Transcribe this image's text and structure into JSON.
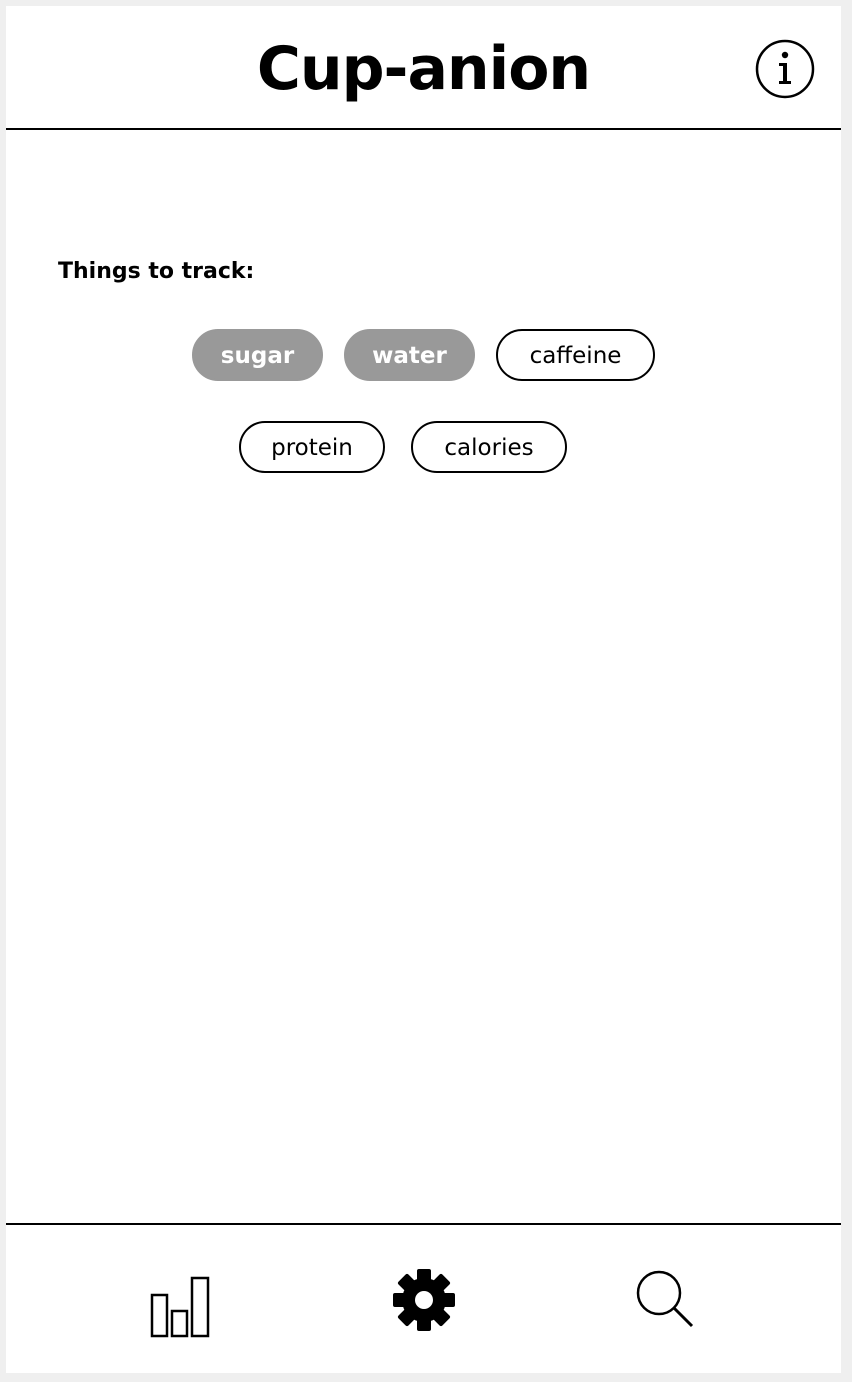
{
  "header": {
    "title": "Cup-anion",
    "info_icon": "info-circle-icon"
  },
  "tracking": {
    "label": "Things to track:",
    "chips": [
      {
        "label": "sugar",
        "selected": true
      },
      {
        "label": "water",
        "selected": true
      },
      {
        "label": "caffeine",
        "selected": false
      },
      {
        "label": "protein",
        "selected": false
      },
      {
        "label": "calories",
        "selected": false
      }
    ]
  },
  "nav": {
    "items": [
      {
        "icon": "bar-chart-icon"
      },
      {
        "icon": "gear-icon",
        "active": true
      },
      {
        "icon": "search-icon"
      }
    ]
  },
  "colors": {
    "selected_chip": "#999999",
    "outline": "#000000",
    "background": "#ffffff"
  }
}
